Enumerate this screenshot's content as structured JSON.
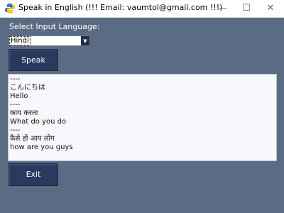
{
  "window": {
    "title": "Speak in English  (!!! Email: vaumtol@gmail.com !!!)",
    "icon": "python-icon",
    "controls": {
      "minimize": "—",
      "maximize": "☐",
      "close": "✕"
    }
  },
  "form": {
    "language_label": "Select Input Language:",
    "language_selected": "Hindi",
    "dropdown_arrow": "▼",
    "speak_label": "Speak",
    "exit_label": "Exit"
  },
  "output": {
    "lines": [
      "----",
      "こんにちは",
      "Hello",
      "----",
      "काय करता",
      "What do you do",
      "----",
      "कैसे हो आप लोग",
      "how are you guys"
    ]
  },
  "colors": {
    "background": "#5a6c84",
    "button": "#2a3a5e",
    "text_area": "#f6f8fb"
  }
}
